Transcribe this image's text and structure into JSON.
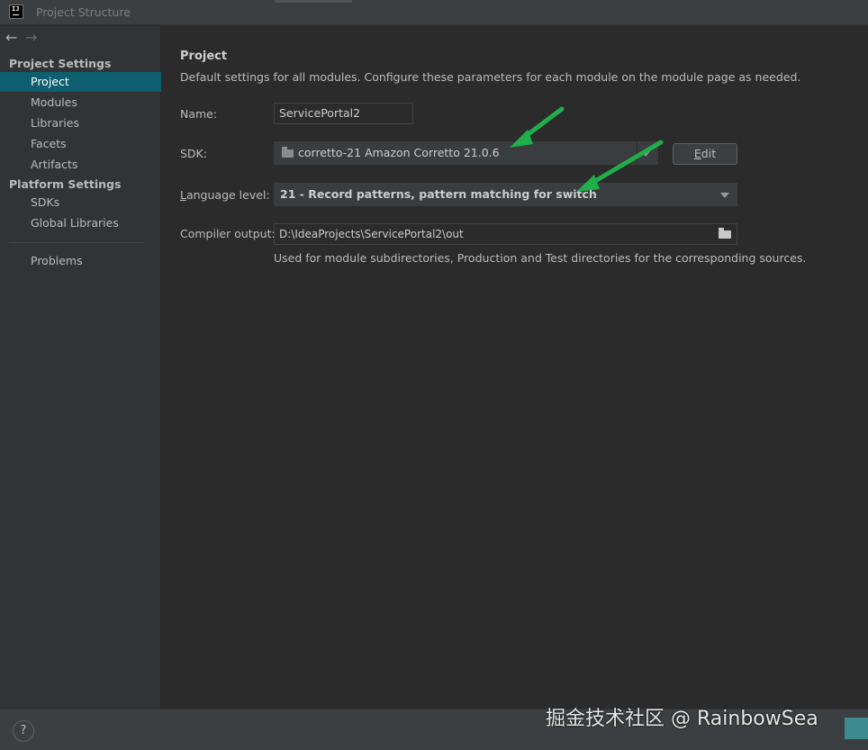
{
  "window": {
    "title": "Project Structure",
    "app_icon_text": "IJ"
  },
  "nav": {
    "back_icon": "←",
    "forward_icon": "→"
  },
  "sidebar": {
    "project_settings_header": "Project Settings",
    "project_settings_items": [
      {
        "label": "Project"
      },
      {
        "label": "Modules"
      },
      {
        "label": "Libraries"
      },
      {
        "label": "Facets"
      },
      {
        "label": "Artifacts"
      }
    ],
    "platform_settings_header": "Platform Settings",
    "platform_settings_items": [
      {
        "label": "SDKs"
      },
      {
        "label": "Global Libraries"
      }
    ],
    "problems_label": "Problems"
  },
  "main": {
    "heading": "Project",
    "description": "Default settings for all modules. Configure these parameters for each module on the module page as needed.",
    "name": {
      "label": "Name:",
      "value": "ServicePortal2"
    },
    "sdk": {
      "label": "SDK:",
      "value": "corretto-21 Amazon Corretto 21.0.6",
      "edit_label": "Edit",
      "edit_mnemonic": "E",
      "edit_rest": "dit"
    },
    "language_level": {
      "label_mnemonic": "L",
      "label_rest": "anguage level:",
      "value": "21 - Record patterns, pattern matching for switch"
    },
    "compiler_output": {
      "label": "Compiler output:",
      "value": "D:\\IdeaProjects\\ServicePortal2\\out"
    },
    "hint": "Used for module subdirectories, Production and Test directories for the corresponding sources."
  },
  "footer": {
    "help_label": "?"
  },
  "watermark": "掘金技术社区 @ RainbowSea",
  "colors": {
    "selection": "#0d5e6e",
    "annotation_arrow": "#1fae4a"
  }
}
